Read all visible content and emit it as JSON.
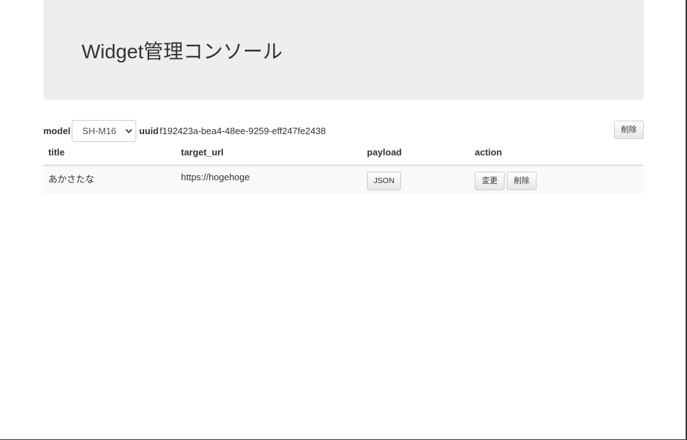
{
  "header": {
    "title": "Widget管理コンソール"
  },
  "toolbar": {
    "model_label": "model",
    "model_value": "SH-M16",
    "uuid_label": "uuid",
    "uuid_value": "f192423a-bea4-48ee-9259-eff247fe2438",
    "delete_label": "削除"
  },
  "table": {
    "headers": [
      "title",
      "target_url",
      "payload",
      "action"
    ],
    "rows": [
      {
        "title": "あかさたな",
        "target_url": "https://hogehoge",
        "payload_button": "JSON",
        "edit_button": "変更",
        "delete_button": "削除"
      }
    ]
  },
  "icons": {
    "select_arrow": "chevron-down-icon"
  }
}
